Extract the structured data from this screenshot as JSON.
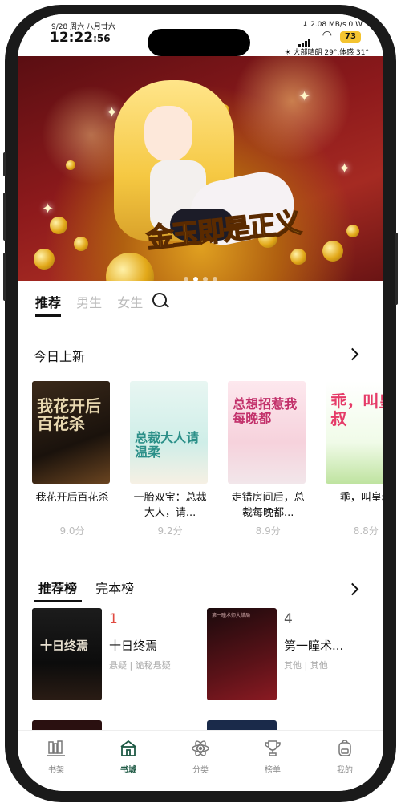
{
  "status": {
    "date": "9/28 周六 八月廿六",
    "time": "12:22",
    "seconds": ":56",
    "net_speed": "↓ 2.08 MB/s  0 W",
    "battery": "73",
    "weather": "☀ 大部晴朗 29°,体感 31°"
  },
  "banner": {
    "title": "金玉即是正义"
  },
  "tabs": [
    {
      "label": "推荐"
    },
    {
      "label": "男生"
    },
    {
      "label": "女生"
    }
  ],
  "new_today": {
    "title": "今日上新",
    "books": [
      {
        "name": "我花开后百花杀",
        "score": "9.0分",
        "cover_text": "我花开后百花杀"
      },
      {
        "name": "一胎双宝：总裁大人，请...",
        "score": "9.2分",
        "cover_text": "总裁大人请温柔"
      },
      {
        "name": "走错房间后，总裁每晚都...",
        "score": "8.9分",
        "cover_text": "总想招惹我 每晚都"
      },
      {
        "name": "乖，叫皇叔",
        "score": "8.8分",
        "cover_text": "乖，叫皇叔"
      }
    ]
  },
  "ranking": {
    "tabs": [
      {
        "label": "推荐榜"
      },
      {
        "label": "完本榜"
      }
    ],
    "items": [
      {
        "rank": "1",
        "name": "十日终焉",
        "genre": "悬疑 | 诡秘悬疑",
        "cover_text": "十日终焉"
      },
      {
        "rank": "4",
        "name": "第一瞳术...",
        "genre": "其他 | 其他",
        "cover_text": "第一瞳术师大结局"
      }
    ]
  },
  "nav": [
    {
      "label": "书架",
      "icon": "bookshelf-icon"
    },
    {
      "label": "书城",
      "icon": "store-icon"
    },
    {
      "label": "分类",
      "icon": "category-icon"
    },
    {
      "label": "榜单",
      "icon": "trophy-icon"
    },
    {
      "label": "我的",
      "icon": "backpack-icon"
    }
  ],
  "colors": {
    "accent": "#1f5a45",
    "rank_top": "#e0493f",
    "rank_other": "#555555"
  }
}
